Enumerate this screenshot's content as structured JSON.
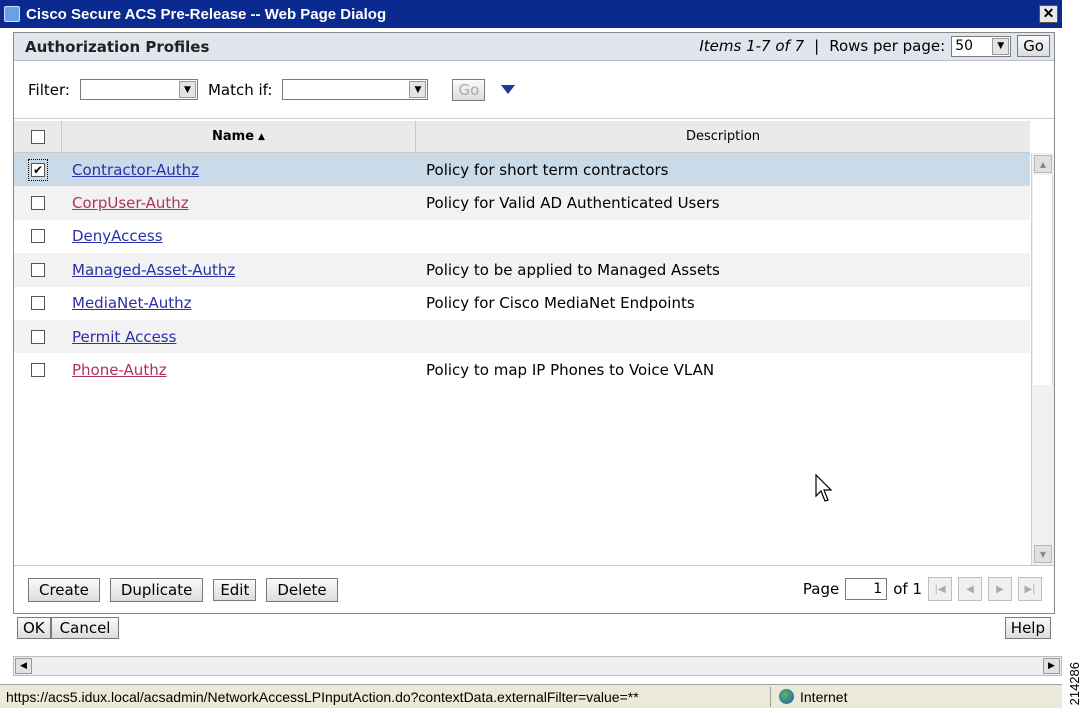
{
  "window": {
    "title": "Cisco Secure ACS Pre-Release -- Web Page Dialog",
    "close_glyph": "✕"
  },
  "panel": {
    "title": "Authorization Profiles",
    "items_text": "Items 1-7 of 7",
    "separator": "|",
    "rows_per_page_label": "Rows per page:",
    "rows_per_page_value": "50",
    "go_label": "Go"
  },
  "filter": {
    "filter_label": "Filter:",
    "filter_value": "",
    "match_label": "Match if:",
    "match_value": "",
    "go_label": "Go"
  },
  "table": {
    "columns": {
      "name": "Name",
      "description": "Description"
    },
    "rows": [
      {
        "name": "Contractor-Authz",
        "description": "Policy for short term contractors",
        "checked": true
      },
      {
        "name": "CorpUser-Authz",
        "description": "Policy for Valid AD Authenticated Users",
        "checked": false
      },
      {
        "name": "DenyAccess",
        "description": "",
        "checked": false
      },
      {
        "name": "Managed-Asset-Authz",
        "description": "Policy to be applied to Managed Assets",
        "checked": false
      },
      {
        "name": "MediaNet-Authz",
        "description": "Policy for Cisco MediaNet Endpoints",
        "checked": false
      },
      {
        "name": "Permit Access",
        "description": "",
        "checked": false
      },
      {
        "name": "Phone-Authz",
        "description": "Policy to map IP Phones to Voice VLAN",
        "checked": false
      }
    ]
  },
  "footer": {
    "create_label": "Create",
    "duplicate_label": "Duplicate",
    "edit_label": "Edit",
    "delete_label": "Delete",
    "page_label": "Page",
    "page_value": "1",
    "of_label": "of 1"
  },
  "dialog": {
    "ok_label": "OK",
    "cancel_label": "Cancel",
    "help_label": "Help"
  },
  "statusbar": {
    "url": "https://acs5.idux.local/acsadmin/NetworkAccessLPInputAction.do?contextData.externalFilter=value=**",
    "zone": "Internet"
  },
  "side_number": "214286"
}
